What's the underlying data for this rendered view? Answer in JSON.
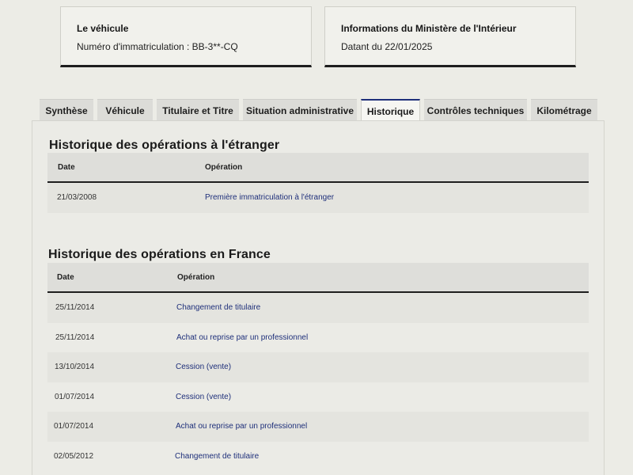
{
  "vehicle_card": {
    "title": "Le véhicule",
    "plate_text": "Numéro d'immatriculation : BB-3**-CQ"
  },
  "ministry_card": {
    "title": "Informations du Ministère de l'Intérieur",
    "date_text": "Datant du 22/01/2025"
  },
  "tabs": [
    {
      "label": "Synthèse",
      "active": false
    },
    {
      "label": "Véhicule",
      "active": false
    },
    {
      "label": "Titulaire et Titre",
      "active": false
    },
    {
      "label": "Situation administrative",
      "active": false
    },
    {
      "label": "Historique",
      "active": true
    },
    {
      "label": "Contrôles techniques",
      "active": false
    },
    {
      "label": "Kilométrage",
      "active": false
    }
  ],
  "foreign_history": {
    "title": "Historique des opérations à l'étranger",
    "headers": {
      "date": "Date",
      "operation": "Opération"
    },
    "rows": [
      {
        "date": "21/03/2008",
        "operation": "Première immatriculation à l'étranger"
      }
    ]
  },
  "france_history": {
    "title": "Historique des opérations en France",
    "headers": {
      "date": "Date",
      "operation": "Opération"
    },
    "rows": [
      {
        "date": "25/11/2014",
        "operation": "Changement de titulaire"
      },
      {
        "date": "25/11/2014",
        "operation": "Achat ou reprise par un professionnel"
      },
      {
        "date": "13/10/2014",
        "operation": "Cession (vente)"
      },
      {
        "date": "01/07/2014",
        "operation": "Cession (vente)"
      },
      {
        "date": "01/07/2014",
        "operation": "Achat ou reprise par un professionnel"
      },
      {
        "date": "02/05/2012",
        "operation": "Changement de titulaire"
      }
    ]
  },
  "colors": {
    "accent": "#1e2f7a",
    "background": "#ecece6"
  }
}
